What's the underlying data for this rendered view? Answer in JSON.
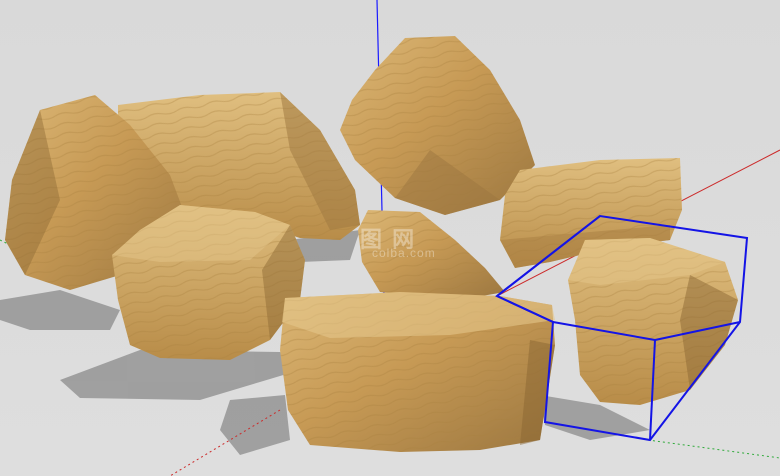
{
  "scene": {
    "background": "#dcdcdc",
    "axis_colors": {
      "blue": "#1a1aff",
      "red": "#cc2a2a",
      "green": "#2faa3a"
    },
    "selection_color": "#1414e6",
    "stone_colors": {
      "light": "#d9b572",
      "mid": "#c0954f",
      "dark": "#8d6a35",
      "shadow": "#6f6f6f"
    },
    "stones": [
      {
        "name": "stone-left-tall"
      },
      {
        "name": "stone-back-flat"
      },
      {
        "name": "stone-back-peak"
      },
      {
        "name": "stone-right-slab"
      },
      {
        "name": "stone-middle-small"
      },
      {
        "name": "stone-left-block"
      },
      {
        "name": "stone-front-large"
      },
      {
        "name": "stone-right-selected"
      }
    ],
    "watermark": {
      "text": "图 网",
      "sub": "colba.com"
    }
  }
}
